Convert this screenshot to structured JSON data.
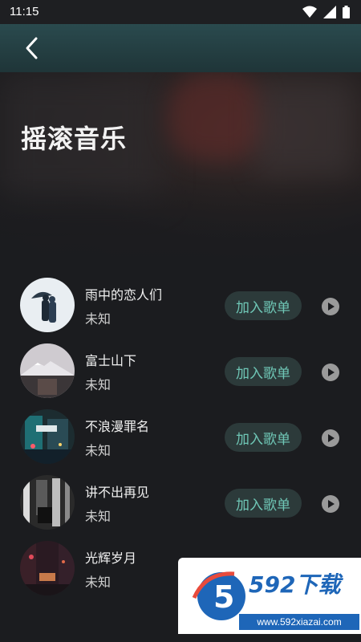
{
  "status_bar": {
    "time": "11:15",
    "icons": [
      "wifi-icon",
      "signal-icon",
      "battery-icon"
    ]
  },
  "app_bar": {
    "back_icon": "chevron-left-icon"
  },
  "header": {
    "title": "摇滚音乐"
  },
  "songs": [
    {
      "title": "雨中的恋人们",
      "artist": "未知",
      "add_label": "加入歌单"
    },
    {
      "title": "富士山下",
      "artist": "未知",
      "add_label": "加入歌单"
    },
    {
      "title": "不浪漫罪名",
      "artist": "未知",
      "add_label": "加入歌单"
    },
    {
      "title": "讲不出再见",
      "artist": "未知",
      "add_label": "加入歌单"
    },
    {
      "title": "光辉岁月",
      "artist": "未知"
    }
  ],
  "watermark": {
    "brand": "592下载",
    "url": "www.592xiazai.com"
  },
  "colors": {
    "accent": "#6fc7b6",
    "background": "#1b1c1f",
    "appbar": "#2a4a4e",
    "watermark_blue": "#1e66b8"
  }
}
